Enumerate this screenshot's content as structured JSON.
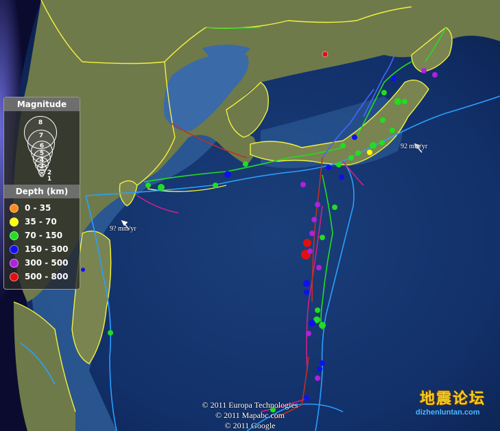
{
  "legend": {
    "magnitude_title": "Magnitude",
    "magnitude_levels": [
      "8",
      "7",
      "6",
      "5",
      "4",
      "3",
      "2",
      "1"
    ],
    "depth_title": "Depth (km)",
    "depth_classes": [
      {
        "label": "0 - 35",
        "color": "#ff8c1a"
      },
      {
        "label": "35 - 70",
        "color": "#ffff00"
      },
      {
        "label": "70 - 150",
        "color": "#22dd22"
      },
      {
        "label": "150 - 300",
        "color": "#1010ee"
      },
      {
        "label": "300 - 500",
        "color": "#b020e0"
      },
      {
        "label": "500 - 800",
        "color": "#e01010"
      }
    ]
  },
  "velocity_labels": [
    "92 mm/yr",
    "9? mm/yr"
  ],
  "credits": [
    "© 2011 Europa Technologies",
    "© 2011 Mapabc.com",
    "© 2011 Google"
  ],
  "watermark": {
    "text": "地震论坛",
    "url": "dizhenluntan.com"
  },
  "colors": {
    "ocean_deep": "#0d2a5c",
    "ocean_shelf": "#2f5f9a",
    "land": "#6f7a4a",
    "border": "#f2f240",
    "plate_boundary": "#2aa0ff"
  },
  "events": [
    {
      "depth_class": 2,
      "mag": 4.5
    },
    {
      "depth_class": 2,
      "mag": 4.5
    },
    {
      "depth_class": 2,
      "mag": 4.5
    },
    {
      "depth_class": 2,
      "mag": 4
    },
    {
      "depth_class": 2,
      "mag": 4
    },
    {
      "depth_class": 2,
      "mag": 4
    },
    {
      "depth_class": 3,
      "mag": 4.5
    },
    {
      "depth_class": 3,
      "mag": 4
    },
    {
      "depth_class": 3,
      "mag": 4
    },
    {
      "depth_class": 4,
      "mag": 4
    },
    {
      "depth_class": 4,
      "mag": 4
    },
    {
      "depth_class": 4,
      "mag": 4
    },
    {
      "depth_class": 5,
      "mag": 5
    },
    {
      "depth_class": 5,
      "mag": 5.5
    },
    {
      "depth_class": 5,
      "mag": 4
    }
  ]
}
